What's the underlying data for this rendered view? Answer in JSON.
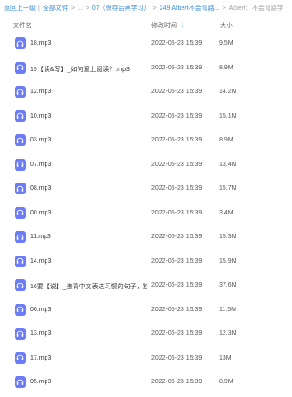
{
  "breadcrumb": {
    "items": [
      "返回上一级",
      "全部文件",
      "...",
      "07（保存后再学习）",
      "249.Albert不会弯路...",
      "Albert：不会弯路学..."
    ]
  },
  "columns": {
    "name": "文件名",
    "modified": "修改时间",
    "size": "大小"
  },
  "icon_color": "#6b7cf6",
  "files": [
    {
      "name": "18.mp3",
      "modified": "2022-05-23 15:39",
      "size": "9.5M"
    },
    {
      "name": "19【读&写】_如何爱上阅读？.mp3",
      "modified": "2022-05-23 15:39",
      "size": "8.9M"
    },
    {
      "name": "12.mp3",
      "modified": "2022-05-23 15:39",
      "size": "14.2M"
    },
    {
      "name": "10.mp3",
      "modified": "2022-05-23 15:39",
      "size": "15.1M"
    },
    {
      "name": "03.mp3",
      "modified": "2022-05-23 15:39",
      "size": "8.9M"
    },
    {
      "name": "07.mp3",
      "modified": "2022-05-23 15:39",
      "size": "13.4M"
    },
    {
      "name": "08.mp3",
      "modified": "2022-05-23 15:39",
      "size": "15.7M"
    },
    {
      "name": "00.mp3",
      "modified": "2022-05-23 15:39",
      "size": "3.4M"
    },
    {
      "name": "11.mp3",
      "modified": "2022-05-23 15:39",
      "size": "15.3M"
    },
    {
      "name": "14.mp3",
      "modified": "2022-05-23 15:39",
      "size": "15.9M"
    },
    {
      "name": "16要【说】_违背中文表达习惯的句子，独...",
      "modified": "2022-05-23 15:39",
      "size": "37.6M"
    },
    {
      "name": "06.mp3",
      "modified": "2022-05-23 15:39",
      "size": "11.5M"
    },
    {
      "name": "13.mp3",
      "modified": "2022-05-23 15:39",
      "size": "12.3M"
    },
    {
      "name": "17.mp3",
      "modified": "2022-05-23 15:39",
      "size": "13M"
    },
    {
      "name": "05.mp3",
      "modified": "2022-05-23 15:39",
      "size": "8.9M"
    }
  ]
}
